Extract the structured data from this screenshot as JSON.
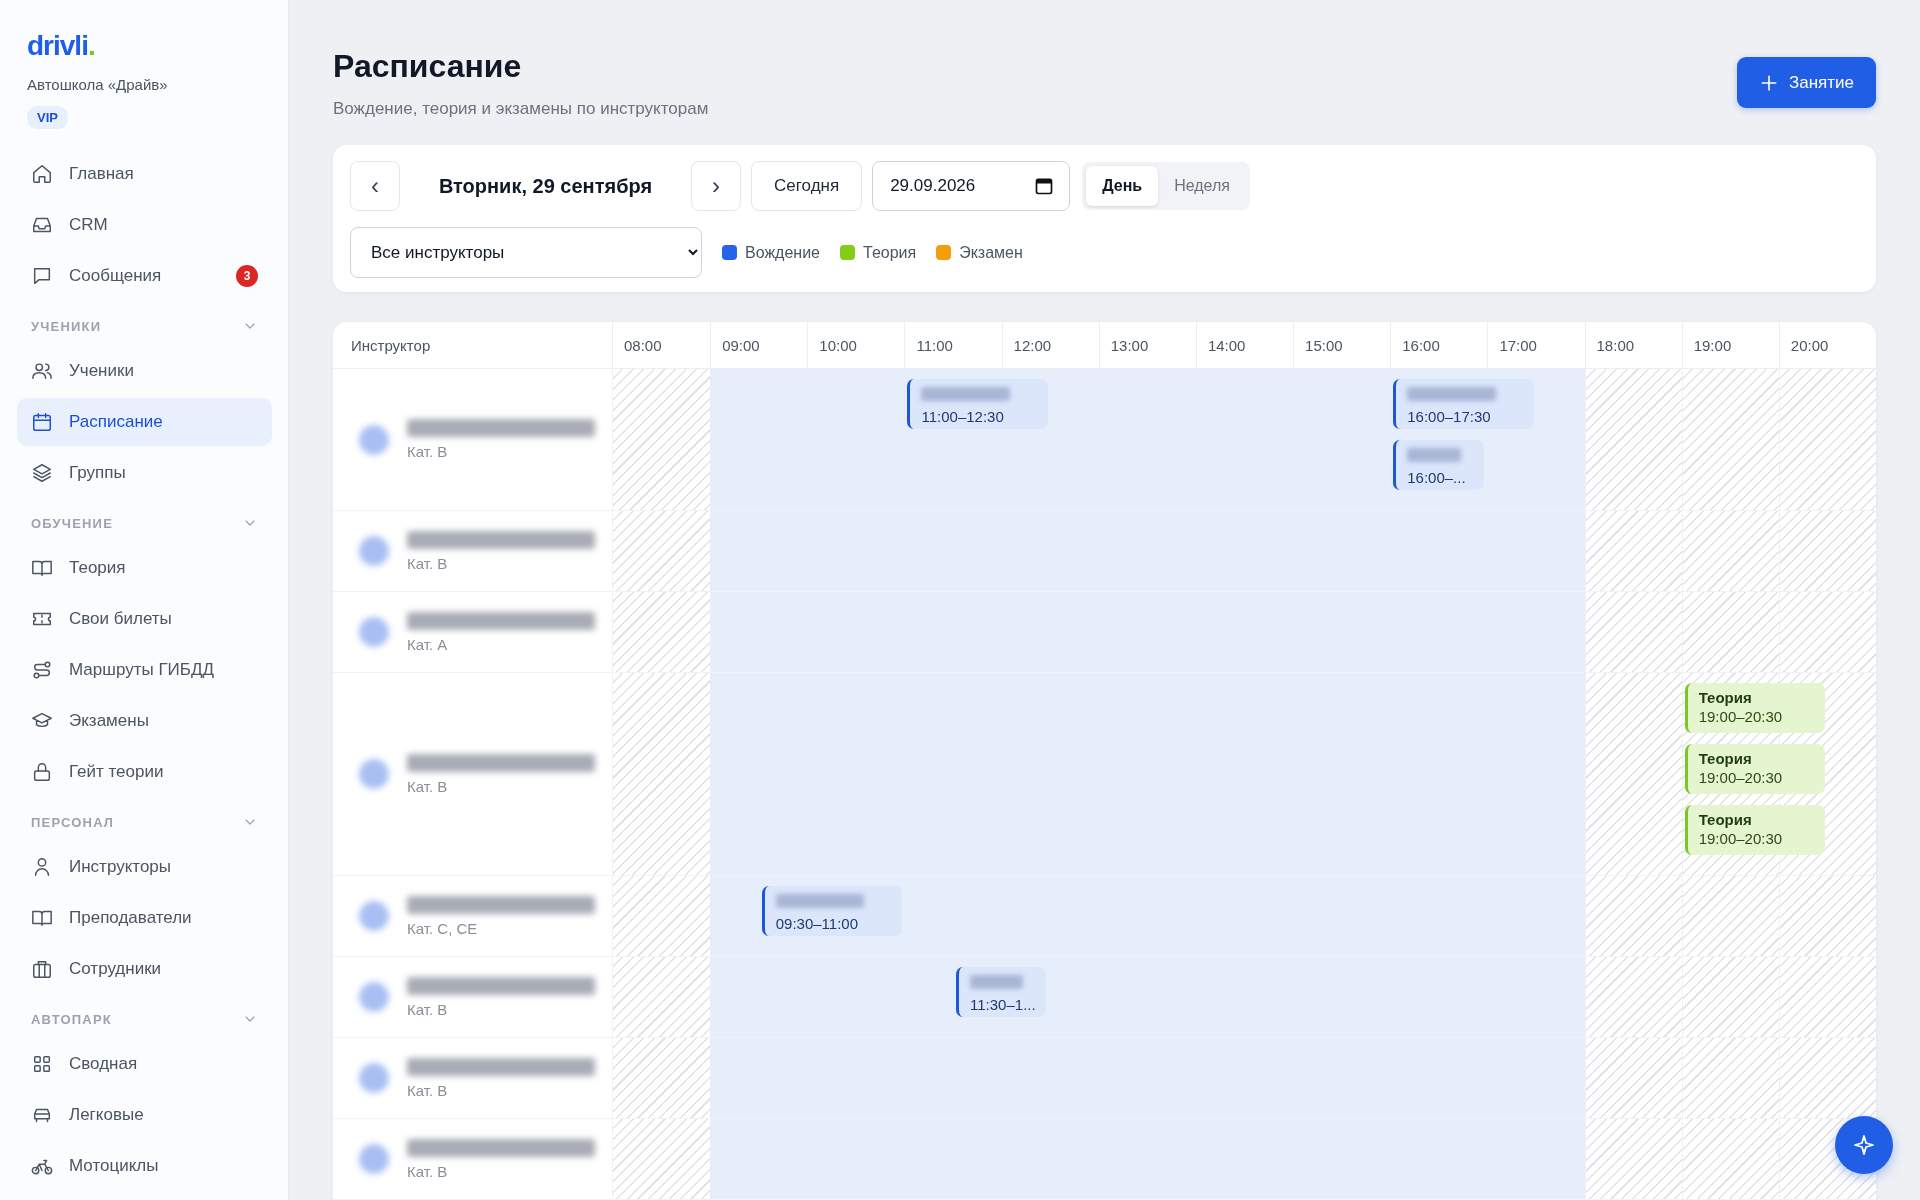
{
  "sidebar": {
    "logo_text": "drivli",
    "logo_dot": ".",
    "school": "Автошкола «Драйв»",
    "plan_badge": "VIP",
    "groups": [
      {
        "items": [
          {
            "label": "Главная",
            "selected": false
          },
          {
            "label": "CRM",
            "selected": false
          },
          {
            "label": "Сообщения",
            "selected": false,
            "badge": "3"
          }
        ]
      },
      {
        "title": "УЧЕНИКИ",
        "expanded": true,
        "items": [
          {
            "label": "Ученики",
            "selected": false
          },
          {
            "label": "Расписание",
            "selected": true
          },
          {
            "label": "Группы",
            "selected": false
          }
        ]
      },
      {
        "title": "ОБУЧЕНИЕ",
        "expanded": true,
        "items": [
          {
            "label": "Теория",
            "selected": false
          },
          {
            "label": "Свои билеты",
            "selected": false
          },
          {
            "label": "Маршруты ГИБДД",
            "selected": false
          },
          {
            "label": "Экзамены",
            "selected": false
          },
          {
            "label": "Гейт теории",
            "selected": false
          }
        ]
      },
      {
        "title": "ПЕРСОНАЛ",
        "expanded": true,
        "items": [
          {
            "label": "Инструкторы",
            "selected": false
          },
          {
            "label": "Преподаватели",
            "selected": false
          },
          {
            "label": "Сотрудники",
            "selected": false
          }
        ]
      },
      {
        "title": "АВТОПАРК",
        "expanded": true,
        "items": [
          {
            "label": "Сводная",
            "selected": false
          },
          {
            "label": "Легковые",
            "selected": false
          },
          {
            "label": "Мотоциклы",
            "selected": false
          }
        ]
      }
    ]
  },
  "header": {
    "title": "Расписание",
    "subtitle": "Вождение, теория и экзамены по инструкторам",
    "add_button": "Занятие"
  },
  "toolbar": {
    "prev": "‹",
    "date_title": "Вторник, 29 сентября",
    "next": "›",
    "today_button": "Сегодня",
    "date_field": "29.09.2026",
    "views": [
      {
        "label": "День",
        "selected": true
      },
      {
        "label": "Неделя",
        "selected": false
      }
    ],
    "instructor_select": "Все инструкторы",
    "legend": [
      {
        "label": "Вождение",
        "color": "#2563eb"
      },
      {
        "label": "Теория",
        "color": "#84cc16"
      },
      {
        "label": "Экзамен",
        "color": "#f59e0b"
      }
    ]
  },
  "grid": {
    "instructor_header": "Инструктор",
    "hours": [
      {
        "label": "08:00",
        "working": false
      },
      {
        "label": "09:00",
        "working": true
      },
      {
        "label": "10:00",
        "working": true
      },
      {
        "label": "11:00",
        "working": true
      },
      {
        "label": "12:00",
        "working": true
      },
      {
        "label": "13:00",
        "working": true
      },
      {
        "label": "14:00",
        "working": true
      },
      {
        "label": "15:00",
        "working": true
      },
      {
        "label": "16:00",
        "working": true
      },
      {
        "label": "17:00",
        "working": true
      },
      {
        "label": "18:00",
        "working": false
      },
      {
        "label": "19:00",
        "working": false
      },
      {
        "label": "20:00",
        "working": false
      }
    ],
    "rows": [
      {
        "category": "Кат. B",
        "events": [
          {
            "kind": "driving",
            "time": "11:00–12:30"
          },
          {
            "kind": "driving",
            "time": "16:00–17:30"
          },
          {
            "kind": "driving",
            "time": "16:00–..."
          }
        ]
      },
      {
        "category": "Кат. B",
        "events": []
      },
      {
        "category": "Кат. A",
        "events": []
      },
      {
        "category": "Кат. B",
        "events": [
          {
            "kind": "theory",
            "title": "Теория",
            "time": "19:00–20:30"
          },
          {
            "kind": "theory",
            "title": "Теория",
            "time": "19:00–20:30"
          },
          {
            "kind": "theory",
            "title": "Теория",
            "time": "19:00–20:30"
          }
        ]
      },
      {
        "category": "Кат. C, CE",
        "events": [
          {
            "kind": "driving",
            "time": "09:30–11:00"
          }
        ]
      },
      {
        "category": "Кат. B",
        "events": [
          {
            "kind": "driving",
            "time": "11:30–1..."
          }
        ]
      },
      {
        "category": "Кат. B",
        "events": []
      },
      {
        "category": "Кат. B",
        "events": []
      }
    ]
  }
}
